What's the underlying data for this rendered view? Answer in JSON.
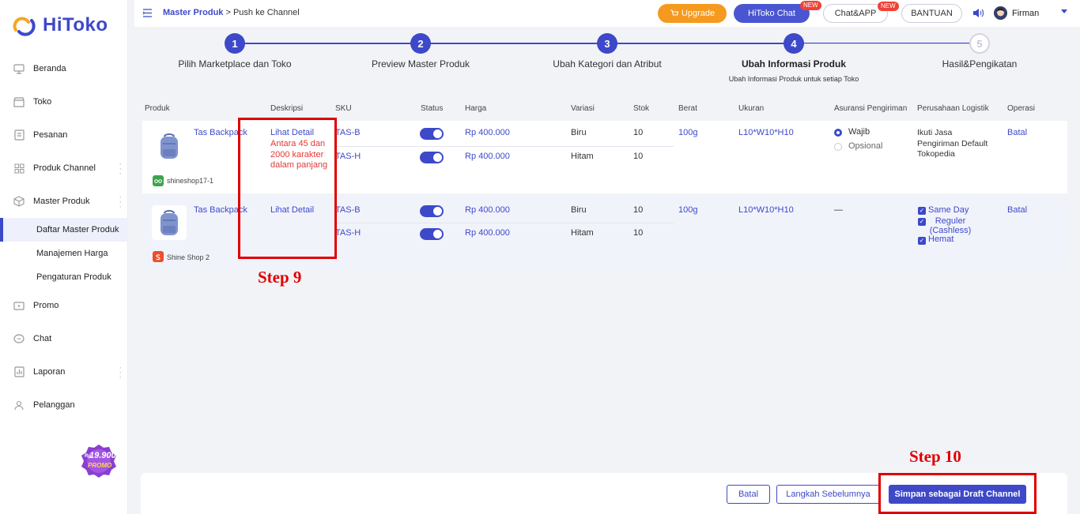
{
  "app": {
    "name": "HiToko"
  },
  "sidebar": {
    "items": [
      {
        "label": "Beranda",
        "icon": "monitor-icon"
      },
      {
        "label": "Toko",
        "icon": "store-icon"
      },
      {
        "label": "Pesanan",
        "icon": "clipboard-icon"
      },
      {
        "label": "Produk Channel",
        "icon": "grid-icon"
      },
      {
        "label": "Master Produk",
        "icon": "cube-icon"
      },
      {
        "label": "Promo",
        "icon": "promo-icon"
      },
      {
        "label": "Chat",
        "icon": "chat-icon"
      },
      {
        "label": "Laporan",
        "icon": "report-icon"
      },
      {
        "label": "Pelanggan",
        "icon": "users-icon"
      }
    ],
    "subitems": [
      {
        "label": "Daftar Master Produk",
        "active": true
      },
      {
        "label": "Manajemen Harga",
        "active": false
      },
      {
        "label": "Pengaturan Produk",
        "active": false
      }
    ],
    "promo": {
      "price": "19.900",
      "prefix": "Rp",
      "label": "PROMO"
    }
  },
  "topbar": {
    "breadcrumb_root": "Master Produk",
    "breadcrumb_rest": " > Push ke Channel",
    "upgrade": "Upgrade",
    "chat": "HiToko Chat",
    "app": "Chat&APP",
    "help": "BANTUAN",
    "new_badge": "NEW",
    "user": "Firman"
  },
  "steps": [
    {
      "num": "1",
      "label": "Pilih Marketplace dan Toko",
      "state": "done"
    },
    {
      "num": "2",
      "label": "Preview Master Produk",
      "state": "done"
    },
    {
      "num": "3",
      "label": "Ubah Kategori dan Atribut",
      "state": "done"
    },
    {
      "num": "4",
      "label": "Ubah Informasi Produk",
      "sub": "Ubah Informasi Produk untuk setiap Toko",
      "state": "current"
    },
    {
      "num": "5",
      "label": "Hasil&Pengikatan",
      "state": "todo"
    }
  ],
  "table": {
    "headers": [
      "Produk",
      "Deskripsi",
      "SKU",
      "Status",
      "Harga",
      "Variasi",
      "Stok",
      "Berat",
      "Ukuran",
      "Asuransi Pengiriman",
      "Perusahaan Logistik",
      "Operasi"
    ],
    "rows": [
      {
        "product": "Tas Backpack",
        "shop": "shineshop17-1",
        "desc_link": "Lihat Detail",
        "desc_error": "Antara 45 dan 2000 karakter dalam panjang",
        "variants": [
          {
            "sku": "TAS-B",
            "price": "Rp 400.000",
            "variation": "Biru",
            "stock": "10"
          },
          {
            "sku": "TAS-H",
            "price": "Rp 400.000",
            "variation": "Hitam",
            "stock": "10"
          }
        ],
        "weight": "100g",
        "size": "L10*W10*H10",
        "insurance_options": [
          "Wajib",
          "Opsional"
        ],
        "logistics": "Ikuti Jasa Pengiriman Default Tokopedia",
        "operation": "Batal"
      },
      {
        "product": "Tas Backpack",
        "shop": "Shine Shop 2",
        "desc_link": "Lihat Detail",
        "variants": [
          {
            "sku": "TAS-B",
            "price": "Rp 400.000",
            "variation": "Biru",
            "stock": "10"
          },
          {
            "sku": "TAS-H",
            "price": "Rp 400.000",
            "variation": "Hitam",
            "stock": "10"
          }
        ],
        "weight": "100g",
        "size": "L10*W10*H10",
        "insurance": "—",
        "logistics_options": [
          "Same Day",
          "Reguler (Cashless)",
          "Hemat"
        ],
        "operation": "Batal"
      }
    ]
  },
  "footer": {
    "cancel": "Batal",
    "prev": "Langkah Sebelumnya",
    "save": "Simpan sebagai Draft Channel"
  },
  "annotations": {
    "step9": "Step 9",
    "step10": "Step 10"
  },
  "colors": {
    "accent": "#3d49c9",
    "upgrade": "#f59a1e",
    "error": "#e53935",
    "annotation": "#e00000"
  }
}
